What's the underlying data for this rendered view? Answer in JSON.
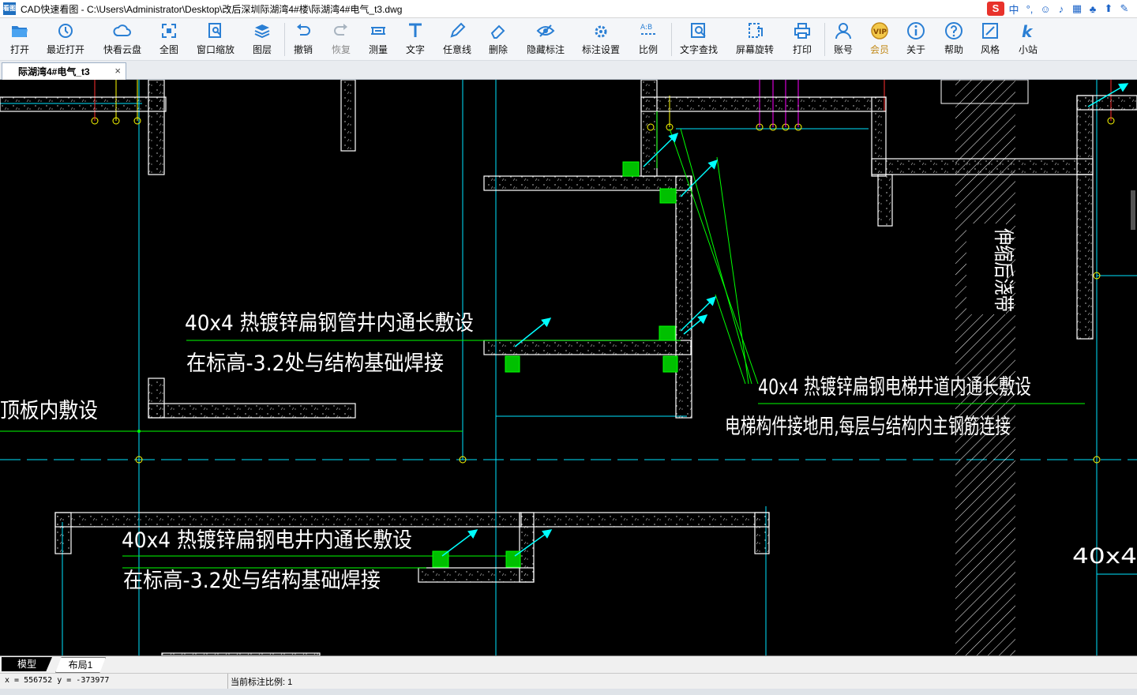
{
  "window": {
    "app_icon": "看图",
    "title": "CAD快速看图 - C:\\Users\\Administrator\\Desktop\\改后深圳际湖湾4#楼\\际湖湾4#电气_t3.dwg"
  },
  "ime": {
    "logo": "S",
    "mode": "中",
    "punct": "°,"
  },
  "toolbar": {
    "open": "打开",
    "recent": "最近打开",
    "cloud": "快看云盘",
    "fit": "全图",
    "window_zoom": "窗口缩放",
    "layers": "图层",
    "undo": "撤销",
    "redo": "恢复",
    "measure": "测量",
    "text": "文字",
    "freeline": "任意线",
    "delete": "删除",
    "hide_marks": "隐藏标注",
    "mark_settings": "标注设置",
    "scale": "比例",
    "text_search": "文字查找",
    "rotate": "屏幕旋转",
    "print": "打印",
    "account": "账号",
    "vip": "会员",
    "about": "关于",
    "help": "帮助",
    "style": "风格",
    "site": "小站"
  },
  "tab": {
    "label": "际湖湾4#电气_t3",
    "close": "×"
  },
  "drawing": {
    "note1_line1": "40x4 热镀锌扁钢管井内通长敷设",
    "note1_line2": "在标高-3.2处与结构基础焊接",
    "note2_line1": "40x4 热镀锌扁钢电梯井道内通长敷设",
    "note2_line2": "电梯构件接地用,每层与结构内主钢筋连接",
    "note3_line1": "40x4 热镀锌扁钢电井内通长敷设",
    "note3_line2": "在标高-3.2处与结构基础焊接",
    "partial_left": "顶板内敷设",
    "partial_right": "40x4",
    "vertical_label": "伸缩后浇带"
  },
  "layout_tabs": {
    "model": "模型",
    "layout1": "布局1"
  },
  "status": {
    "coords": "x = 556752  y = -373977",
    "scale": "当前标注比例: 1"
  },
  "colors": {
    "wall": "#ffffff",
    "axis": "#00e5ff",
    "ground": "#00ff00",
    "arrow": "#00ffff",
    "magenta": "#ff00ff",
    "red": "#ff3030",
    "yellow": "#ffff00"
  }
}
